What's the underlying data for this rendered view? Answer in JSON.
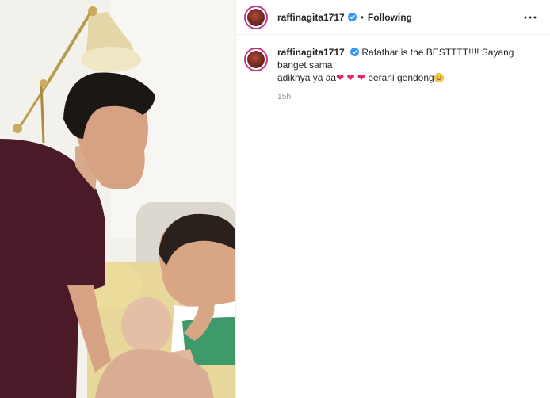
{
  "post": {
    "username": "raffinagita1717",
    "follow_status": "Following",
    "separator": "•",
    "caption_line1": "Rafathar is the BESTTTT!!!! Sayang banget sama",
    "caption_line2": "adiknya ya aa",
    "hearts": [
      "❤",
      "❤",
      "❤"
    ],
    "caption_end": "berani gendong",
    "timestamp": "15h"
  },
  "icons": {
    "verified": "verified-badge-icon",
    "more": "more-options-icon",
    "emoji": "smiling-face-emoji"
  },
  "colors": {
    "verified_blue": "#3897f0",
    "avatar_ring": "#c13584",
    "heart": "#e0245e"
  }
}
